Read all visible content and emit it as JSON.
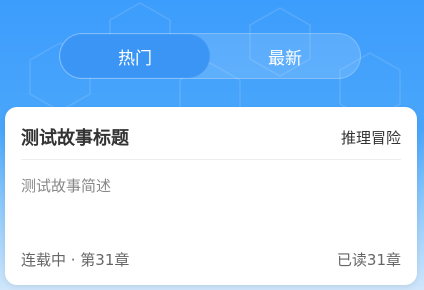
{
  "colors": {
    "header_blue": "#3d9dfc",
    "active_tab": "#3a95f5",
    "card_bg": "#ffffff",
    "title_text": "#333333",
    "muted_text": "#888888"
  },
  "tabs": [
    {
      "label": "热门",
      "active": true
    },
    {
      "label": "最新",
      "active": false
    }
  ],
  "story": {
    "title": "测试故事标题",
    "category": "推理冒险",
    "description": "测试故事简述",
    "status": "连载中 · 第31章",
    "progress": "已读31章"
  }
}
